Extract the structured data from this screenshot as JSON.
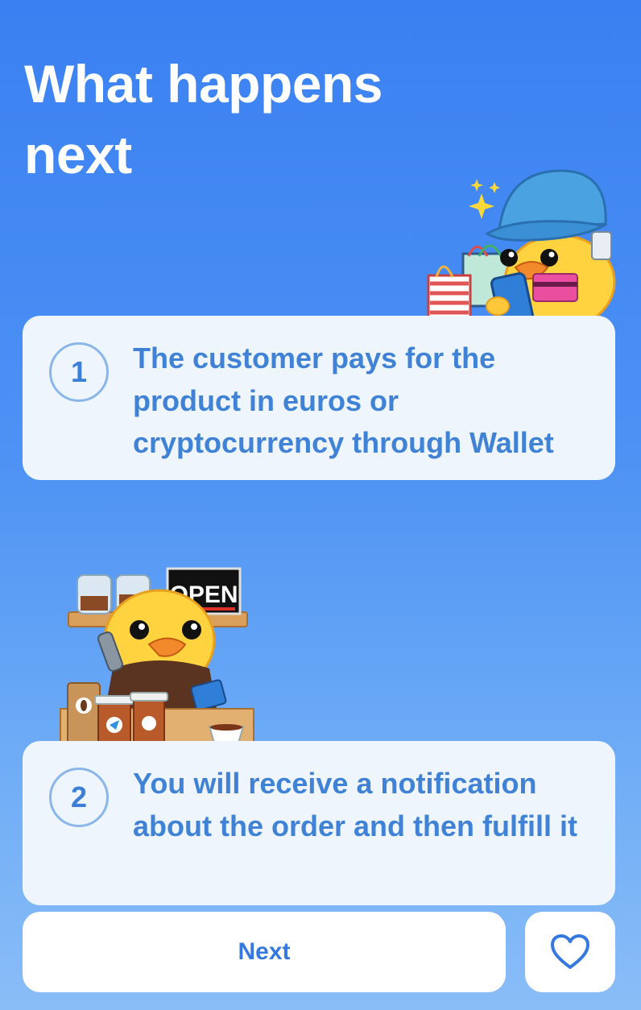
{
  "header": {
    "title": "What happens next"
  },
  "steps": [
    {
      "number": "1",
      "text": "The customer pays for the product in euros or cryptocurrency through Wallet",
      "illustration": "duck-shopper-with-phone-and-bags"
    },
    {
      "number": "2",
      "text": "You will receive a notification about the order and then fulfill it",
      "illustration": "duck-barista-at-coffee-counter",
      "sign_text": "OPEN"
    }
  ],
  "footer": {
    "next_label": "Next",
    "favorite_icon": "heart-icon"
  },
  "colors": {
    "accent": "#3478e0",
    "background_top": "#3a80f2",
    "background_bottom": "#89bdf7",
    "card": "#eef5fd",
    "step_text": "#3f82d6"
  }
}
